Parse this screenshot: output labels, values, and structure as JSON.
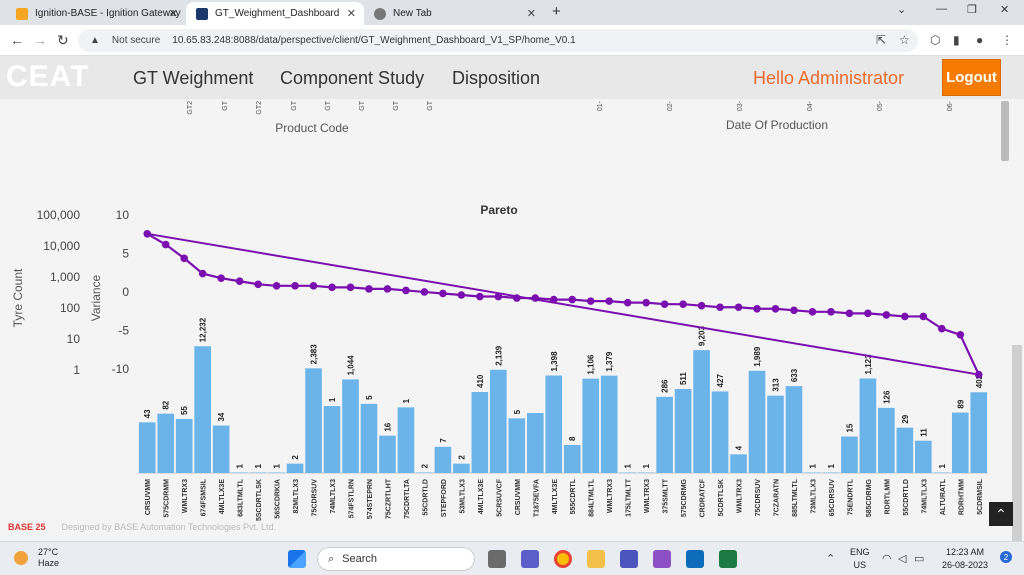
{
  "browser": {
    "tabs": [
      {
        "title": "Ignition-BASE - Ignition Gateway",
        "active": false
      },
      {
        "title": "GT_Weighment_Dashboard",
        "active": true
      },
      {
        "title": "New Tab",
        "active": false
      }
    ],
    "not_secure": "Not secure",
    "url": "10.65.83.248:8088/data/perspective/client/GT_Weighment_Dashboard_V1_SP/home_V0.1"
  },
  "header": {
    "logo": "CEAT",
    "nav": [
      "GT Weighment",
      "Component Study",
      "Disposition"
    ],
    "greeting": "Hello Administrator",
    "logout": "Logout"
  },
  "upper_charts": {
    "left_axis_label": "Product Code",
    "left_tick_fragments": [
      "GT2",
      "GT",
      "GT2",
      "GT",
      "GT",
      "GT",
      "GT",
      "GT"
    ],
    "right_axis_label": "Date Of Production",
    "right_tick_fragments": [
      "01-",
      "02-",
      "03-",
      "04-",
      "05-",
      "06-"
    ]
  },
  "chart_data": {
    "type": "bar",
    "title": "Pareto",
    "y_left_label": "Tyre Count",
    "y_left_ticks": [
      "100,000",
      "10,000",
      "1,000",
      "100",
      "10",
      "1"
    ],
    "y_left_scale": "log",
    "y_right_label": "Variance",
    "y_right_ticks": [
      "10",
      "5",
      "0",
      "-5",
      "-10"
    ],
    "y_right_range": [
      -10,
      10
    ],
    "categories": [
      "CRSUVMM",
      "575CDRMM",
      "WMLTRX3",
      "674FSMSIL",
      "4MLTLX3E",
      "683LTMLTL",
      "5SCDRTLSK",
      "56SCDRKIA",
      "82MLTLX3",
      "75CDRSUV",
      "74MLTLX3",
      "574FSTLRN",
      "574STEPRN",
      "75CZRTLHT",
      "75CDRTLTA",
      "55CDRTLD",
      "STEPFORD",
      "53MLTLX3",
      "4MLTLX3E",
      "5CRSUVCF",
      "CRSUVMM",
      "T1875EVFA",
      "4MLTLX3E",
      "555CDRTL",
      "884LTMLTL",
      "WMLTRX3",
      "175LTMLTT",
      "WMLTRX3",
      "375SMLTT",
      "575CDRMG",
      "CRDRATCF",
      "5CDRTLSK",
      "WMLTRX3",
      "75CDRSUV",
      "7CZARATN",
      "885LTMLTL",
      "73MLTLX3",
      "65CDRSUV",
      "75ENDRTL",
      "585CDRMG",
      "RDRTLMM",
      "55CDRTLD",
      "74MLTLX3",
      "ALTURATL",
      "RDRHTMM",
      "5CDRMSIL"
    ],
    "tyre_count": [
      43,
      82,
      55,
      12232,
      34,
      1,
      1,
      1,
      2,
      2383,
      144,
      1044,
      170,
      16,
      131,
      1,
      7,
      2,
      410,
      2139,
      58,
      86,
      1398,
      8,
      1106,
      1379,
      1,
      1,
      286,
      511,
      9203,
      427,
      4,
      1989,
      313,
      633,
      1,
      1,
      15,
      1123,
      126,
      29,
      11,
      1,
      89,
      402
    ],
    "bar_labels": [
      "43",
      "82",
      "55",
      "12,232",
      "34",
      "1",
      "1",
      "1",
      "2",
      "2,383",
      "1",
      "1,044",
      "5",
      "16",
      "1",
      "2",
      "7",
      "2",
      "410",
      "2,139",
      "5",
      "",
      "1,398",
      "8",
      "1,106",
      "1,379",
      "1",
      "1",
      "286",
      "511",
      "9,203",
      "427",
      "4",
      "1,989",
      "313",
      "633",
      "1",
      "1",
      "15",
      "1,123",
      "126",
      "29",
      "11",
      "1",
      "89",
      "402"
    ],
    "variance_line": [
      4.0,
      3.3,
      2.4,
      1.4,
      1.1,
      0.9,
      0.7,
      0.6,
      0.6,
      0.6,
      0.5,
      0.5,
      0.4,
      0.4,
      0.3,
      0.2,
      0.1,
      0.0,
      -0.1,
      -0.1,
      -0.2,
      -0.2,
      -0.3,
      -0.3,
      -0.4,
      -0.4,
      -0.5,
      -0.5,
      -0.6,
      -0.6,
      -0.7,
      -0.8,
      -0.8,
      -0.9,
      -0.9,
      -1.0,
      -1.1,
      -1.1,
      -1.2,
      -1.2,
      -1.3,
      -1.4,
      -1.4,
      -2.2,
      -2.6,
      -5.2
    ],
    "trend_line": [
      4.0,
      -5.2
    ],
    "series_colors": {
      "bars": "#6ab4ea",
      "line": "#7a0fb0"
    }
  },
  "footer": {
    "brand": "BASE 25",
    "credit": "Designed by BASE Automation Technologies Pvt. Ltd."
  },
  "taskbar": {
    "temp": "27°C",
    "weather": "Haze",
    "search": "Search",
    "lang1": "ENG",
    "lang2": "US",
    "time": "12:23 AM",
    "date": "26-08-2023",
    "notifications": "2"
  }
}
